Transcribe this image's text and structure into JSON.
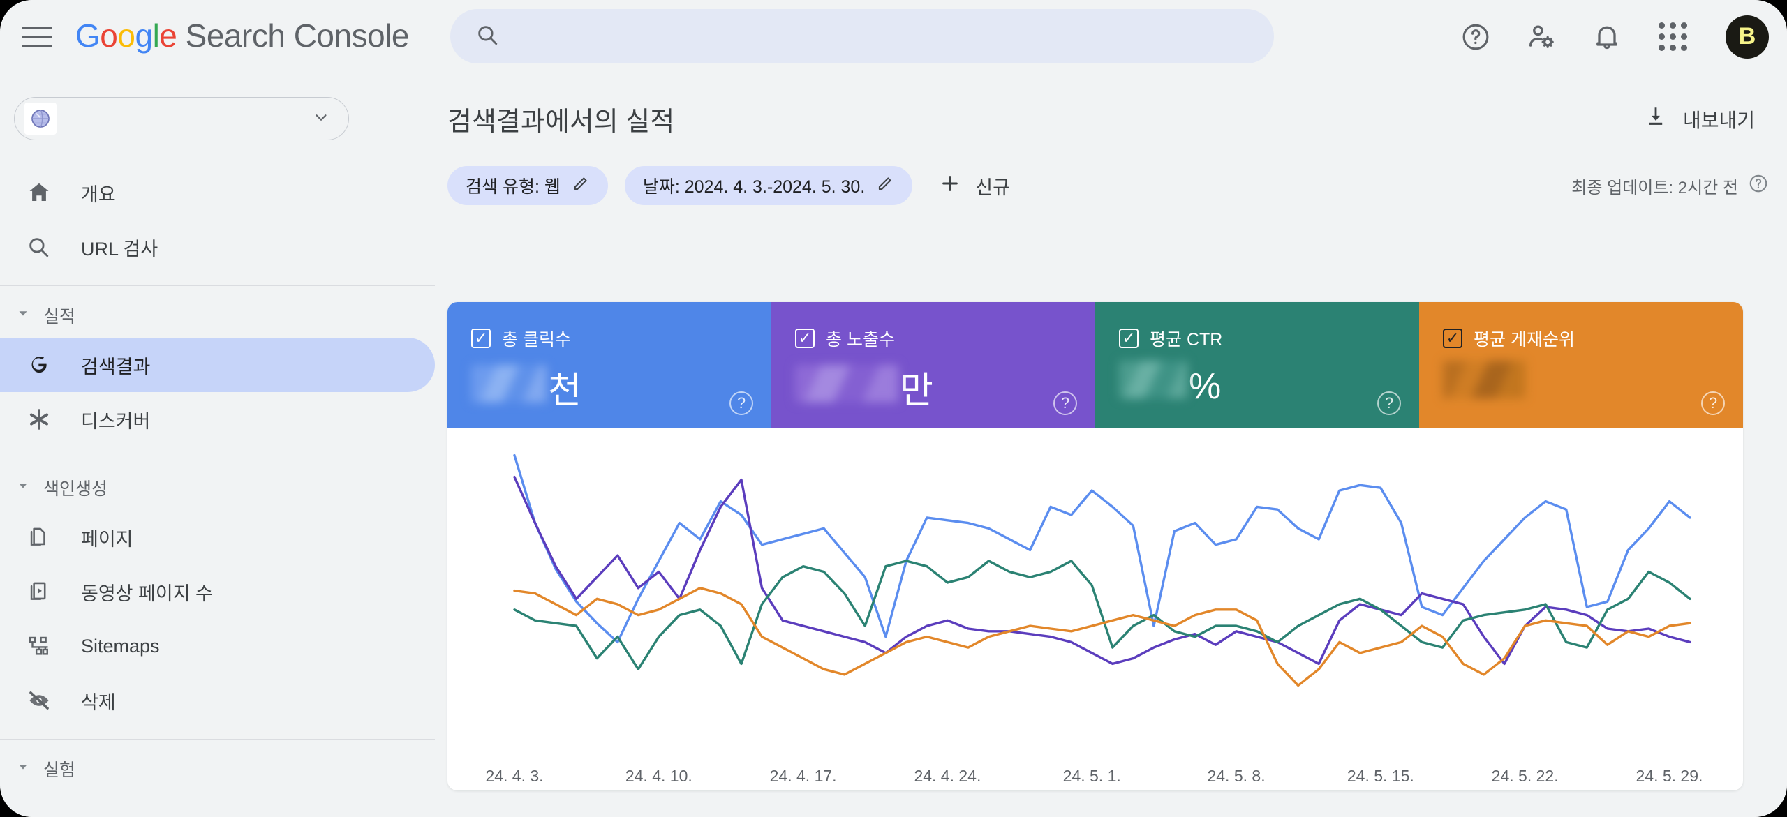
{
  "topbar": {
    "menu_icon": "hamburger-icon",
    "brand": {
      "g": "G",
      "o1": "o",
      "o2": "o",
      "g2": "g",
      "l": "l",
      "e": "e",
      "rest": " Search Console"
    },
    "search": {
      "placeholder": "",
      "value": "",
      "icon": "search-icon"
    },
    "icons": [
      {
        "name": "help-icon",
        "glyph": "?"
      },
      {
        "name": "account-settings-icon",
        "glyph": ""
      },
      {
        "name": "notifications-bell-icon",
        "glyph": ""
      },
      {
        "name": "google-apps-grid-icon",
        "glyph": ""
      }
    ],
    "avatar_letter": "B"
  },
  "sidebar": {
    "property": {
      "icon": "globe-property-icon",
      "label": "",
      "caret": "chevron-down-icon"
    },
    "items": [
      {
        "label": "개요",
        "icon": "home-icon",
        "active": false
      },
      {
        "label": "URL 검사",
        "icon": "search-icon",
        "active": false
      }
    ],
    "group_performance": {
      "label": "실적",
      "caret": "caret-down-icon"
    },
    "performance_items": [
      {
        "label": "검색결과",
        "icon": "google-g-icon",
        "active": true
      },
      {
        "label": "디스커버",
        "icon": "discover-asterisk-icon",
        "active": false
      }
    ],
    "group_indexing": {
      "label": "색인생성",
      "caret": "caret-down-icon"
    },
    "indexing_items": [
      {
        "label": "페이지",
        "icon": "pages-icon",
        "active": false
      },
      {
        "label": "동영상 페이지 수",
        "icon": "video-pages-icon",
        "active": false
      },
      {
        "label": "Sitemaps",
        "icon": "sitemaps-icon",
        "active": false
      },
      {
        "label": "삭제",
        "icon": "removals-eye-off-icon",
        "active": false
      }
    ],
    "group_experiments": {
      "label": "실험",
      "caret": "caret-down-icon"
    }
  },
  "main": {
    "page_title": "검색결과에서의 실적",
    "export": {
      "label": "내보내기",
      "icon": "download-icon"
    },
    "chips": [
      {
        "label": "검색 유형: 웹",
        "edit_icon": "pencil-icon"
      },
      {
        "label": "날짜: 2024. 4. 3.-2024. 5. 30.",
        "edit_icon": "pencil-icon"
      }
    ],
    "new_filter": {
      "label": "신규",
      "icon": "plus-icon"
    },
    "last_update": {
      "label": "최종 업데이트: 2시간 전",
      "help_icon": "help-circle-icon"
    },
    "metrics": [
      {
        "name": "total-clicks",
        "label": "총 클릭수",
        "suffix": "천",
        "value_redacted": true,
        "color": "#4f86e8",
        "checked": true,
        "help": "?"
      },
      {
        "name": "total-impressions",
        "label": "총 노출수",
        "suffix": "만",
        "value_redacted": true,
        "color": "#7753cc",
        "checked": true,
        "help": "?"
      },
      {
        "name": "average-ctr",
        "label": "평균 CTR",
        "suffix": "%",
        "value_redacted": true,
        "color": "#2b8273",
        "checked": true,
        "help": "?"
      },
      {
        "name": "average-position",
        "label": "평균 게재순위",
        "suffix": "",
        "value_redacted": true,
        "color": "#e2872a",
        "checked": true,
        "help": "?"
      }
    ]
  },
  "chart_data": {
    "type": "line",
    "title": "검색결과에서의 실적",
    "xlabel": "",
    "ylabel": "",
    "grid": false,
    "legend": "none",
    "tick_labels": [
      "24. 4. 3.",
      "24. 4. 10.",
      "24. 4. 17.",
      "24. 4. 24.",
      "24. 5. 1.",
      "24. 5. 8.",
      "24. 5. 15.",
      "24. 5. 22.",
      "24. 5. 29."
    ],
    "tick_indices": [
      0,
      7,
      14,
      21,
      28,
      35,
      42,
      49,
      56
    ],
    "x": [
      "2024-04-03",
      "2024-04-04",
      "2024-04-05",
      "2024-04-06",
      "2024-04-07",
      "2024-04-08",
      "2024-04-09",
      "2024-04-10",
      "2024-04-11",
      "2024-04-12",
      "2024-04-13",
      "2024-04-14",
      "2024-04-15",
      "2024-04-16",
      "2024-04-17",
      "2024-04-18",
      "2024-04-19",
      "2024-04-20",
      "2024-04-21",
      "2024-04-22",
      "2024-04-23",
      "2024-04-24",
      "2024-04-25",
      "2024-04-26",
      "2024-04-27",
      "2024-04-28",
      "2024-04-29",
      "2024-04-30",
      "2024-05-01",
      "2024-05-02",
      "2024-05-03",
      "2024-05-04",
      "2024-05-05",
      "2024-05-06",
      "2024-05-07",
      "2024-05-08",
      "2024-05-09",
      "2024-05-10",
      "2024-05-11",
      "2024-05-12",
      "2024-05-13",
      "2024-05-14",
      "2024-05-15",
      "2024-05-16",
      "2024-05-17",
      "2024-05-18",
      "2024-05-19",
      "2024-05-20",
      "2024-05-21",
      "2024-05-22",
      "2024-05-23",
      "2024-05-24",
      "2024-05-25",
      "2024-05-26",
      "2024-05-27",
      "2024-05-28",
      "2024-05-29",
      "2024-05-30"
    ],
    "ylim": [
      0,
      100
    ],
    "series": [
      {
        "name": "총 클릭수",
        "color": "#5b8def",
        "values": [
          97,
          72,
          55,
          43,
          35,
          28,
          44,
          58,
          72,
          66,
          80,
          75,
          64,
          66,
          68,
          70,
          61,
          52,
          30,
          58,
          74,
          73,
          72,
          70,
          66,
          62,
          78,
          75,
          84,
          78,
          71,
          34,
          69,
          72,
          64,
          66,
          78,
          77,
          70,
          66,
          84,
          86,
          85,
          72,
          41,
          38,
          48,
          58,
          66,
          74,
          80,
          77,
          41,
          43,
          62,
          70,
          80,
          74
        ]
      },
      {
        "name": "총 노출수",
        "color": "#5b3dbd",
        "values": [
          89,
          72,
          56,
          44,
          52,
          60,
          48,
          54,
          44,
          62,
          78,
          88,
          48,
          36,
          34,
          32,
          30,
          28,
          24,
          30,
          34,
          36,
          33,
          32,
          32,
          31,
          30,
          28,
          24,
          20,
          22,
          26,
          29,
          31,
          27,
          32,
          30,
          28,
          24,
          20,
          36,
          42,
          40,
          38,
          46,
          44,
          42,
          30,
          20,
          34,
          41,
          40,
          38,
          33,
          32,
          33,
          30,
          28
        ]
      },
      {
        "name": "평균 CTR",
        "color": "#2b8273",
        "values": [
          40,
          36,
          35,
          34,
          22,
          30,
          18,
          30,
          38,
          40,
          34,
          20,
          42,
          52,
          56,
          54,
          46,
          34,
          56,
          58,
          56,
          50,
          52,
          58,
          54,
          52,
          54,
          58,
          49,
          26,
          34,
          38,
          32,
          30,
          34,
          34,
          32,
          28,
          34,
          38,
          42,
          44,
          40,
          34,
          28,
          26,
          36,
          38,
          39,
          40,
          42,
          28,
          26,
          40,
          44,
          54,
          50,
          44
        ]
      },
      {
        "name": "평균 게재순위",
        "color": "#e2872a",
        "values": [
          47,
          46,
          42,
          38,
          44,
          42,
          38,
          40,
          44,
          48,
          46,
          42,
          30,
          26,
          22,
          18,
          16,
          20,
          24,
          28,
          30,
          28,
          26,
          30,
          32,
          34,
          33,
          32,
          34,
          36,
          38,
          36,
          34,
          38,
          40,
          40,
          36,
          20,
          12,
          18,
          28,
          24,
          26,
          28,
          34,
          30,
          20,
          16,
          22,
          34,
          36,
          35,
          34,
          27,
          32,
          30,
          34,
          35
        ]
      }
    ]
  }
}
